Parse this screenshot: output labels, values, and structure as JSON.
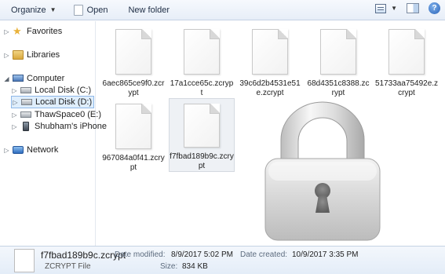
{
  "toolbar": {
    "organize_label": "Organize",
    "open_label": "Open",
    "new_folder_label": "New folder",
    "help_label": "?"
  },
  "nav": {
    "favorites": "Favorites",
    "libraries": "Libraries",
    "computer": "Computer",
    "local_c": "Local Disk (C:)",
    "local_d": "Local Disk (D:)",
    "thawspace": "ThawSpace0 (E:)",
    "iphone": "Shubham's iPhone",
    "network": "Network"
  },
  "files": [
    {
      "name": "6aec865ce9f0.zcrypt"
    },
    {
      "name": "17a1cce65c.zcrypt"
    },
    {
      "name": "39c6d2b4531e51e.zcrypt"
    },
    {
      "name": "68d4351c8388.zcrypt"
    },
    {
      "name": "51733aa75492e.zcrypt"
    },
    {
      "name": "967084a0f41.zcrypt"
    },
    {
      "name": "f7fbad189b9c.zcrypt"
    }
  ],
  "details": {
    "name": "f7fbad189b9c.zcrypt",
    "type": "ZCRYPT File",
    "modified_label": "Date modified:",
    "modified_value": "8/9/2017 5:02 PM",
    "size_label": "Size:",
    "size_value": "834 KB",
    "created_label": "Date created:",
    "created_value": "10/9/2017 3:35 PM"
  },
  "colors": {
    "toolbar_bg": "#e7eef8",
    "selection": "#dfeefc",
    "lock_body": "#cfcfcf"
  }
}
